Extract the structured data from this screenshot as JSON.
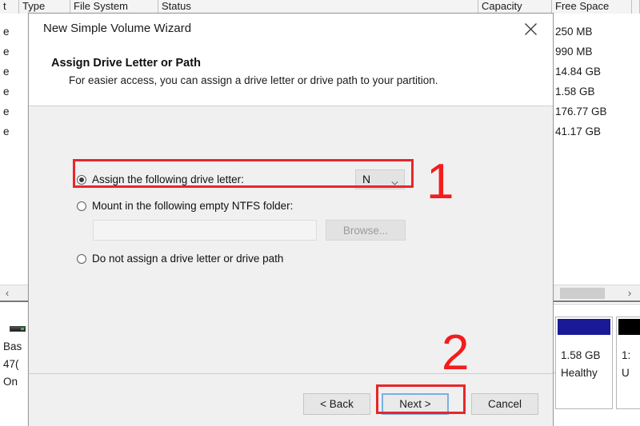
{
  "background": {
    "columns": [
      {
        "label": "t"
      },
      {
        "label": "Type"
      },
      {
        "label": "File System"
      },
      {
        "label": "Status"
      },
      {
        "label": "Capacity"
      },
      {
        "label": "Free Space"
      }
    ],
    "rows": [
      {
        "name": "e",
        "free_space": "250 MB"
      },
      {
        "name": "e",
        "free_space": "990 MB"
      },
      {
        "name": "e",
        "free_space": "14.84 GB"
      },
      {
        "name": "e",
        "free_space": "1.58 GB"
      },
      {
        "name": "e",
        "free_space": "176.77 GB"
      },
      {
        "name": "e",
        "free_space": "41.17 GB"
      }
    ],
    "scrollbar": {
      "left_arrow": "‹",
      "right_arrow": "›"
    },
    "disk_panel": {
      "disk_label_lines": [
        "Bas",
        "47(",
        "On"
      ],
      "partitions": [
        {
          "bar_color": "#1a1a96",
          "size": "1.58 GB",
          "status": "Healthy"
        },
        {
          "bar_color": "#000000",
          "size": "1:",
          "status": "U"
        }
      ]
    }
  },
  "dialog": {
    "window_title": "New Simple Volume Wizard",
    "close_icon": "close-icon",
    "page_title": "Assign Drive Letter or Path",
    "page_subtitle": "For easier access, you can assign a drive letter or drive path to your partition.",
    "options": [
      {
        "id": "assign-letter",
        "label": "Assign the following drive letter:",
        "selected": true
      },
      {
        "id": "mount-ntfs",
        "label": "Mount in the following empty NTFS folder:",
        "selected": false
      },
      {
        "id": "no-letter",
        "label": "Do not assign a drive letter or drive path",
        "selected": false
      }
    ],
    "drive_letter": {
      "value": "N",
      "chevron_icon": "chevron-down-icon"
    },
    "mount_path": {
      "value": "",
      "placeholder": ""
    },
    "browse_button": {
      "label": "Browse...",
      "enabled": false
    },
    "footer_buttons": [
      {
        "id": "back",
        "label": "< Back",
        "focused": false
      },
      {
        "id": "next",
        "label": "Next >",
        "focused": true
      },
      {
        "id": "cancel",
        "label": "Cancel",
        "focused": false
      }
    ]
  },
  "annotations": {
    "accent_color": "#f41c1c",
    "highlight_color": "#e8262a",
    "steps": [
      {
        "number": "1"
      },
      {
        "number": "2"
      }
    ]
  }
}
